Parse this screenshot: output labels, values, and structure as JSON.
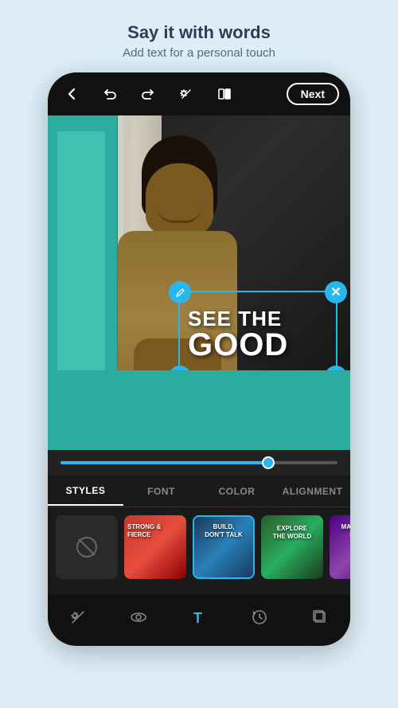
{
  "header": {
    "title": "Say it with words",
    "subtitle": "Add text for a personal touch"
  },
  "topbar": {
    "next_label": "Next",
    "back_icon": "←",
    "undo_icon": "↩",
    "redo_icon": "↪",
    "magic_icon": "✦",
    "compare_icon": "⧉"
  },
  "text_overlay": {
    "line1": "SEE THE",
    "line2": "GOOD",
    "edit_icon": "✎",
    "close_icon": "✕",
    "rotate_icon": "↻",
    "scale_icon": "⤢"
  },
  "slider": {
    "value": 75
  },
  "tabs": [
    {
      "label": "STYLES",
      "active": true
    },
    {
      "label": "FONT",
      "active": false
    },
    {
      "label": "COLOR",
      "active": false
    },
    {
      "label": "ALIGNMENT",
      "active": false
    }
  ],
  "style_cards": [
    {
      "id": "none",
      "label": "None"
    },
    {
      "id": "strong-fierce",
      "label": "STRONG & FIERCE",
      "active": false
    },
    {
      "id": "build-dont-talk",
      "label": "BUILD, DON'T TALK",
      "active": true
    },
    {
      "id": "explore-the-world",
      "label": "EXPLORE THE WORLD",
      "active": false
    },
    {
      "id": "make-it",
      "label": "MAKE IT SIG...",
      "active": false
    }
  ],
  "bottom_toolbar": [
    {
      "id": "effects",
      "icon": "✦",
      "active": false
    },
    {
      "id": "eye",
      "icon": "◉",
      "active": false
    },
    {
      "id": "text",
      "icon": "T",
      "active": true
    },
    {
      "id": "undo",
      "icon": "↩",
      "active": false
    },
    {
      "id": "layers",
      "icon": "⊞",
      "active": false
    }
  ]
}
